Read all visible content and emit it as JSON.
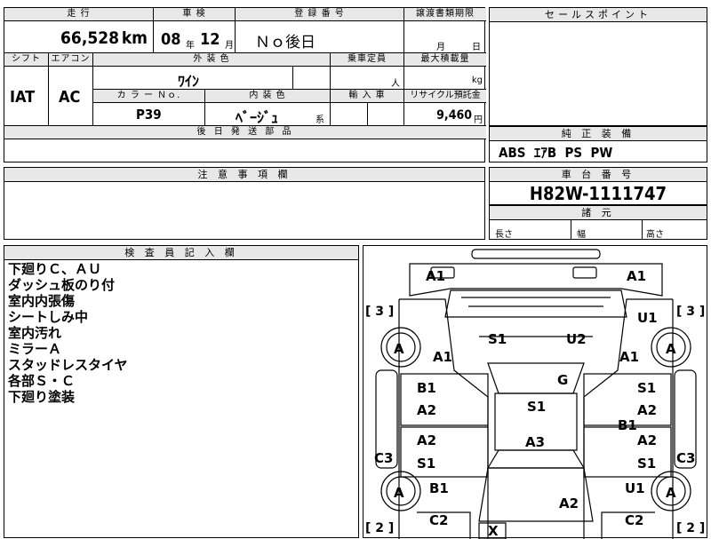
{
  "spec": {
    "mileage_label": "走 行",
    "shaken_label": "車 検",
    "reg_label": "登 録 番 号",
    "transfer_label": "譲渡書類期限",
    "mileage_value": "66,528",
    "mileage_unit": "km",
    "shaken_year": "08",
    "shaken_year_unit": "年",
    "shaken_month": "12",
    "shaken_month_unit": "月",
    "reg_value": "Ｎｏ後日",
    "transfer_month": "月",
    "transfer_day": "日",
    "shift_label": "シフト",
    "ac_label": "エアコン",
    "ext_color_label": "外 装 色",
    "capacity_label": "乗車定員",
    "load_label": "最大積載量",
    "shift_value": "IAT",
    "ac_value": "AC",
    "ext_color_value": "ﾜｲﾝ",
    "capacity_unit": "人",
    "load_unit": "kg",
    "color_no_label": "カ ラ ー Ｎｏ.",
    "int_color_label": "内 装 色",
    "import_label": "輸 入 車",
    "recycle_label": "リサイクル預託金",
    "color_no_value": "P39",
    "int_color_value": "ﾍﾞｰｼﾞｭ",
    "int_color_suffix": "系",
    "recycle_value": "9,460",
    "recycle_unit": "円",
    "later_parts_label": "後 日 発 送 部 品"
  },
  "sales_point": {
    "label": "セールスポイント"
  },
  "equipment": {
    "label": "純 正 装 備",
    "value": "ABS  ｴｱB  PS  PW"
  },
  "caution": {
    "label": "注 意 事 項 欄"
  },
  "chassis": {
    "label": "車 台 番 号",
    "value": "H82W-1111747"
  },
  "dimensions": {
    "label": "諸 元",
    "length": "長さ",
    "width": "幅",
    "height": "高さ"
  },
  "inspector": {
    "label": "検 査 員 記 入 欄",
    "lines": [
      "下廻りＣ、ＡＵ",
      "ダッシュ板のり付",
      "室内内張傷",
      "シートしみ中",
      "室内汚れ",
      "ミラーＡ",
      "スタッドレスタイヤ",
      "各部Ｓ・Ｃ",
      "下廻り塗装"
    ]
  },
  "diagram": {
    "marks": {
      "front_left": "A1",
      "front_right": "A1",
      "left_tire_front": "A",
      "right_tire_front": "A",
      "left_tire_rear": "A",
      "right_tire_rear": "A",
      "left_fender": "A1",
      "right_fender": "A1",
      "hood_left": "S1",
      "hood_right": "U2",
      "windshield": "G",
      "roof": "S1",
      "trunk": "A3",
      "rear_center": "A2",
      "lf_door_a": "B1",
      "lf_door_b": "A2",
      "lr_door_a": "A2",
      "lr_door_b": "S1",
      "rf_door_a": "S1",
      "rf_door_b": "A2",
      "rf_door_c": "B1",
      "rr_door_a": "A2",
      "rr_door_b": "S1",
      "left_quarter": "B1",
      "right_quarter": "U1",
      "right_top_u1": "U1",
      "left_side": "C3",
      "right_side": "C3",
      "rear_left": "C2",
      "rear_right": "C2",
      "rear_x": "X"
    },
    "tire_front_left_num": "[ 3 ]",
    "tire_front_right_num": "[ 3 ]",
    "tire_rear_left_num": "[ 2 ]",
    "tire_rear_right_num": "[ 2 ]"
  }
}
